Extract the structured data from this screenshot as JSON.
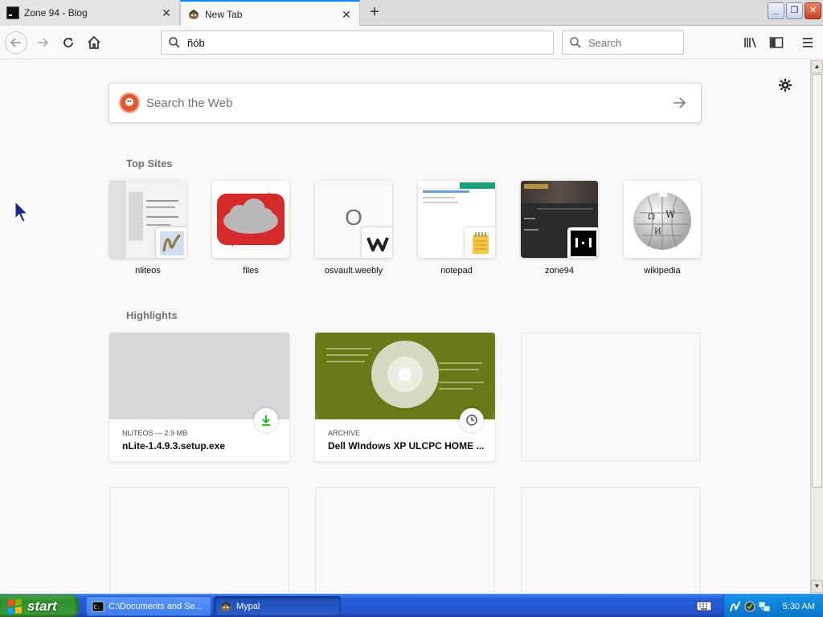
{
  "browser": {
    "tabs": [
      {
        "title": "Zone 94 - Blog",
        "active": false
      },
      {
        "title": "New Tab",
        "active": true
      }
    ],
    "url_value": "ñób",
    "search_placeholder": "Search"
  },
  "newtab": {
    "search_placeholder": "Search the Web",
    "top_sites_heading": "Top Sites",
    "top_sites": [
      {
        "label": "nliteos"
      },
      {
        "label": "files"
      },
      {
        "label": "osvault.weebly",
        "letter": "O"
      },
      {
        "label": "notepad"
      },
      {
        "label": "zone94"
      },
      {
        "label": "wikipedia"
      }
    ],
    "highlights_heading": "Highlights",
    "highlights": [
      {
        "meta": "NLITEOS — 2.9 MB",
        "title": "nLite-1.4.9.3.setup.exe",
        "icon": "download-icon"
      },
      {
        "meta": "ARCHIVE",
        "title": "Dell WIndows XP ULCPC HOME ...",
        "icon": "clock-icon"
      }
    ]
  },
  "taskbar": {
    "start_label": "start",
    "buttons": [
      {
        "label": "C:\\Documents and Se..."
      },
      {
        "label": "Mypal"
      }
    ],
    "clock": "5:30 AM"
  },
  "colors": {
    "accent": "#0a84ff",
    "ddg": "#de5833",
    "xp_taskbar": "#245edb",
    "xp_start": "#3a9a3a",
    "download_green": "#12bc00"
  }
}
